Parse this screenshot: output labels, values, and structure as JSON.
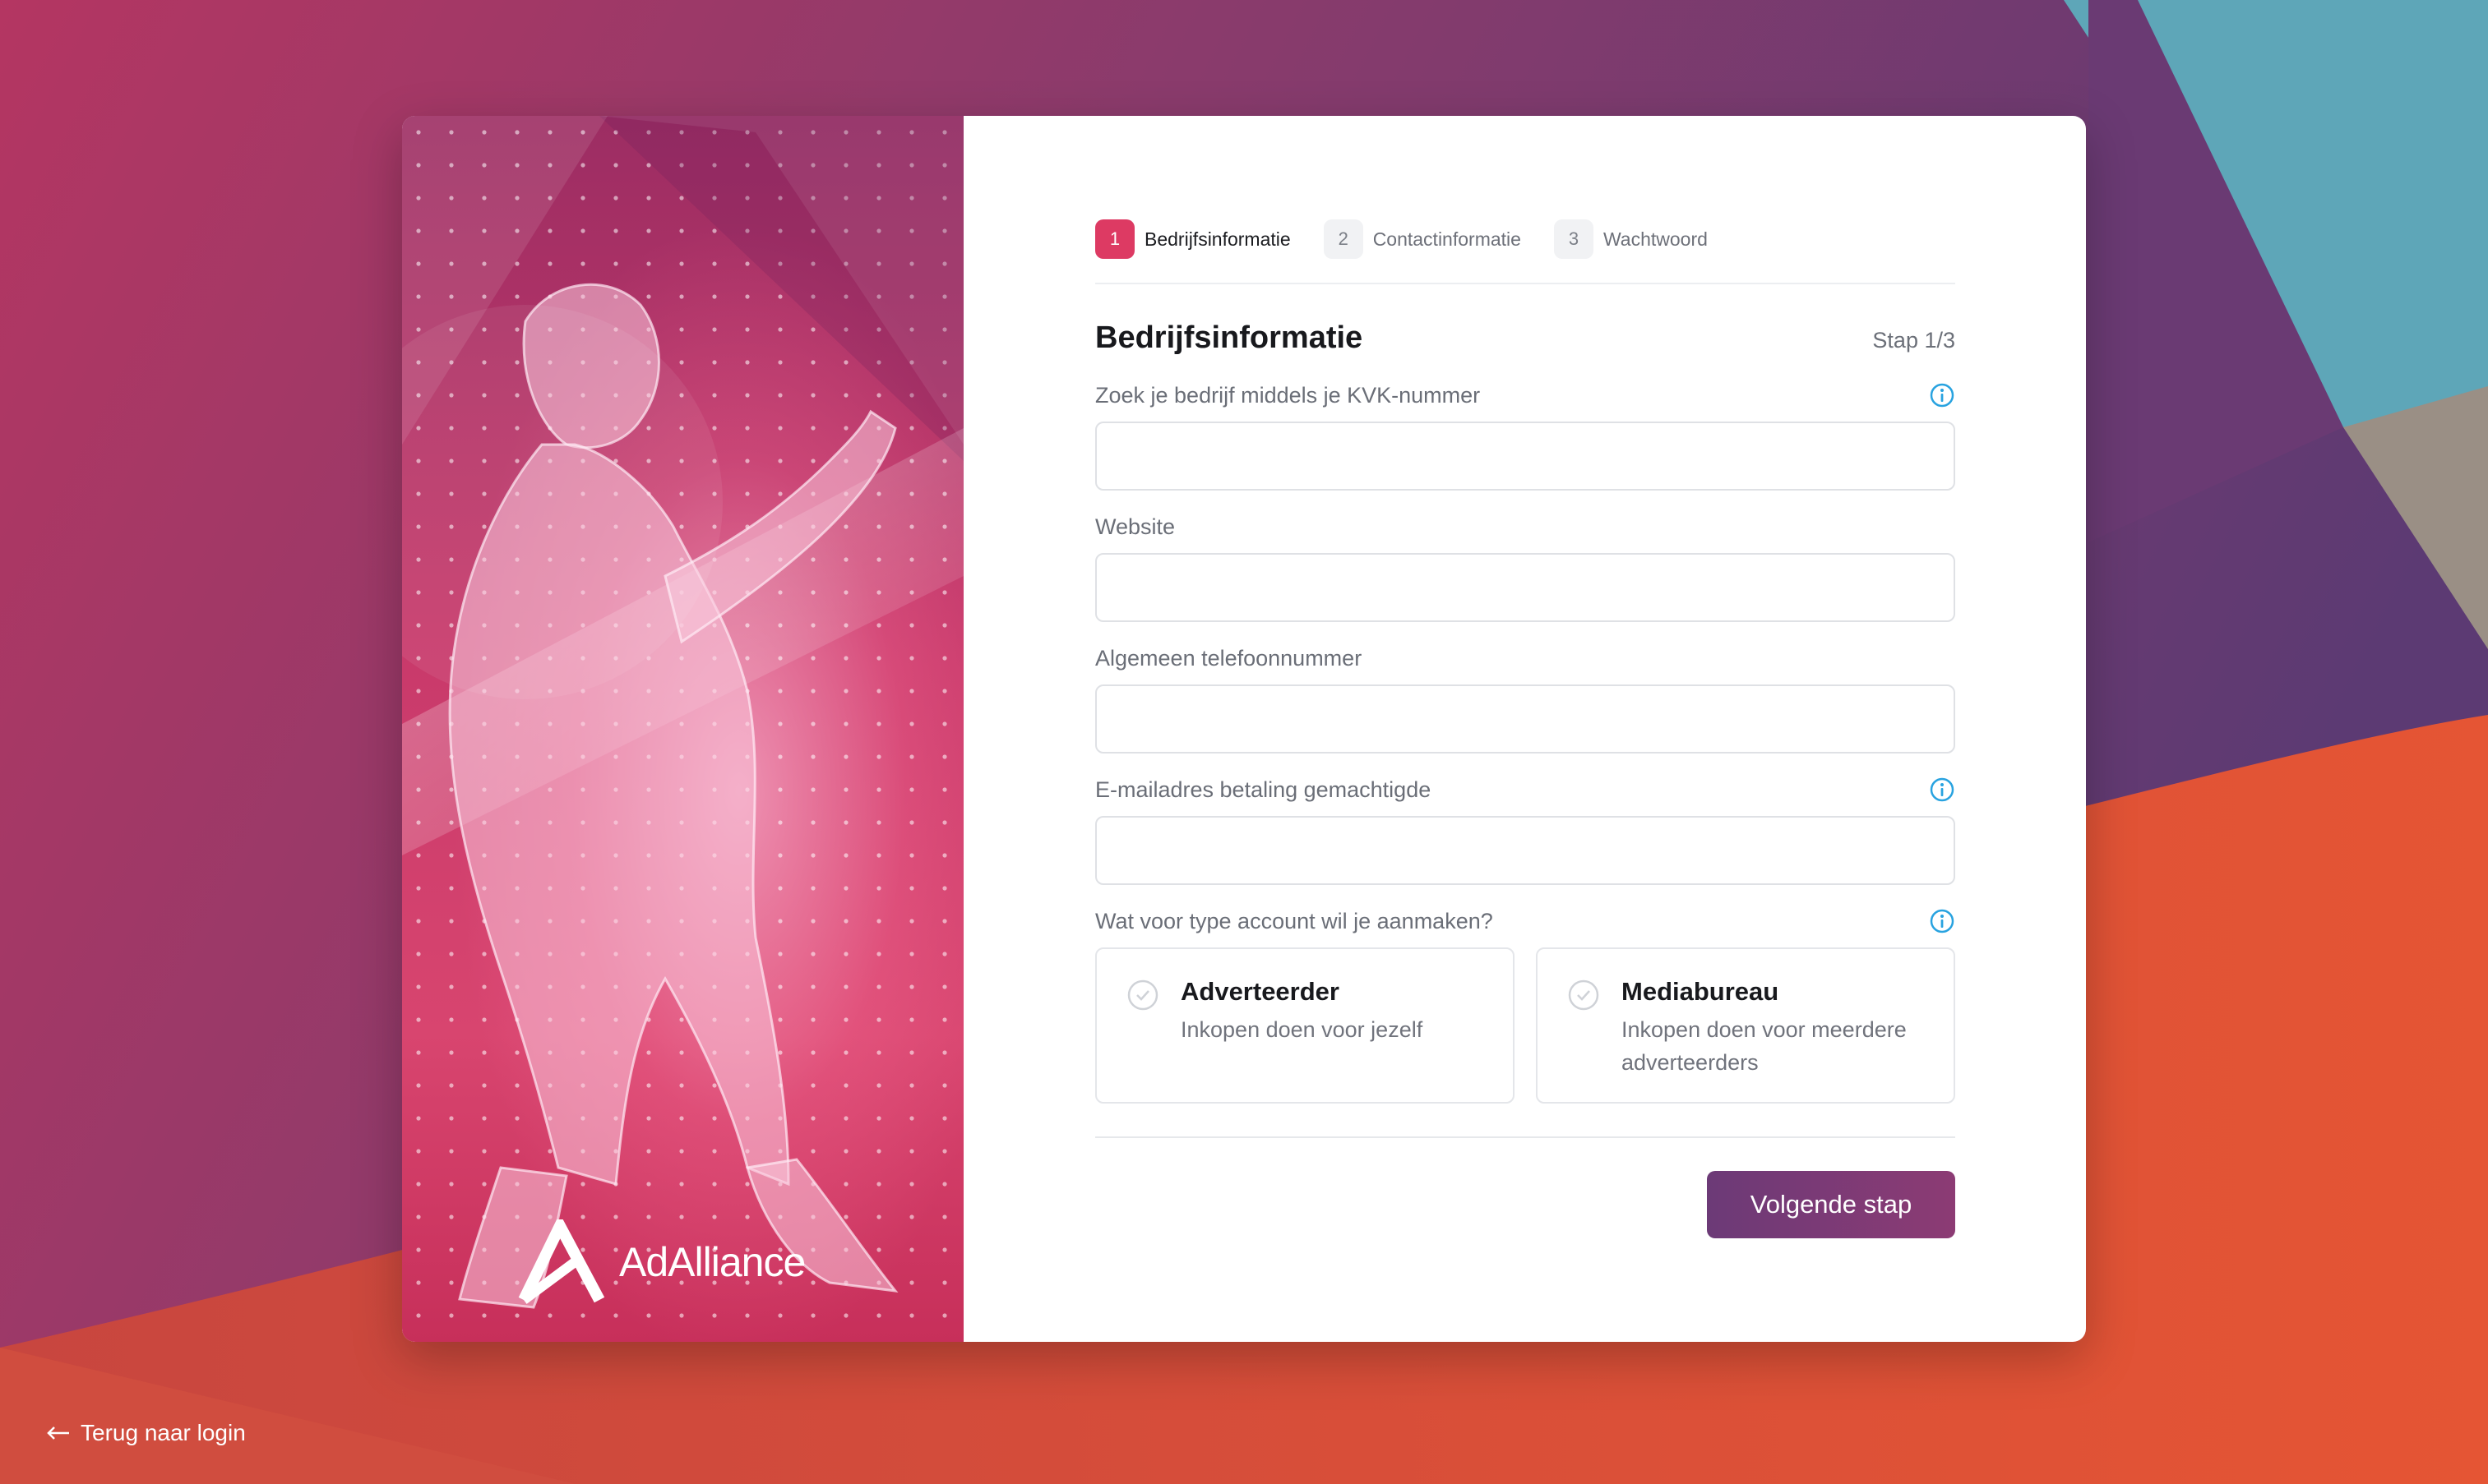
{
  "stepper": {
    "steps": [
      {
        "number": "1",
        "label": "Bedrijfsinformatie"
      },
      {
        "number": "2",
        "label": "Contactinformatie"
      },
      {
        "number": "3",
        "label": "Wachtwoord"
      }
    ]
  },
  "section": {
    "title": "Bedrijfsinformatie",
    "step_indicator": "Stap 1/3"
  },
  "fields": {
    "kvk": {
      "label": "Zoek je bedrijf middels je KVK-nummer",
      "value": "",
      "placeholder": ""
    },
    "website": {
      "label": "Website",
      "value": "",
      "placeholder": ""
    },
    "phone": {
      "label": "Algemeen telefoonnummer",
      "value": "",
      "placeholder": ""
    },
    "email": {
      "label": "E-mailadres betaling gemachtigde",
      "value": "",
      "placeholder": ""
    }
  },
  "account_type": {
    "label": "Wat voor type account wil je aanmaken?",
    "options": [
      {
        "title": "Adverteerder",
        "description": "Inkopen doen voor jezelf"
      },
      {
        "title": "Mediabureau",
        "description": "Inkopen doen voor meerdere adverteerders"
      }
    ]
  },
  "actions": {
    "next_label": "Volgende stap"
  },
  "footer": {
    "back_label": "Terug naar login"
  },
  "brand": {
    "logo_text": "AdAlliance"
  },
  "icons": {
    "info": "info-icon",
    "check": "check-circle-icon",
    "back": "arrow-left-icon"
  },
  "colors": {
    "accent": "#dd3a63",
    "button": "#7a3a75",
    "info": "#29a3e0"
  }
}
